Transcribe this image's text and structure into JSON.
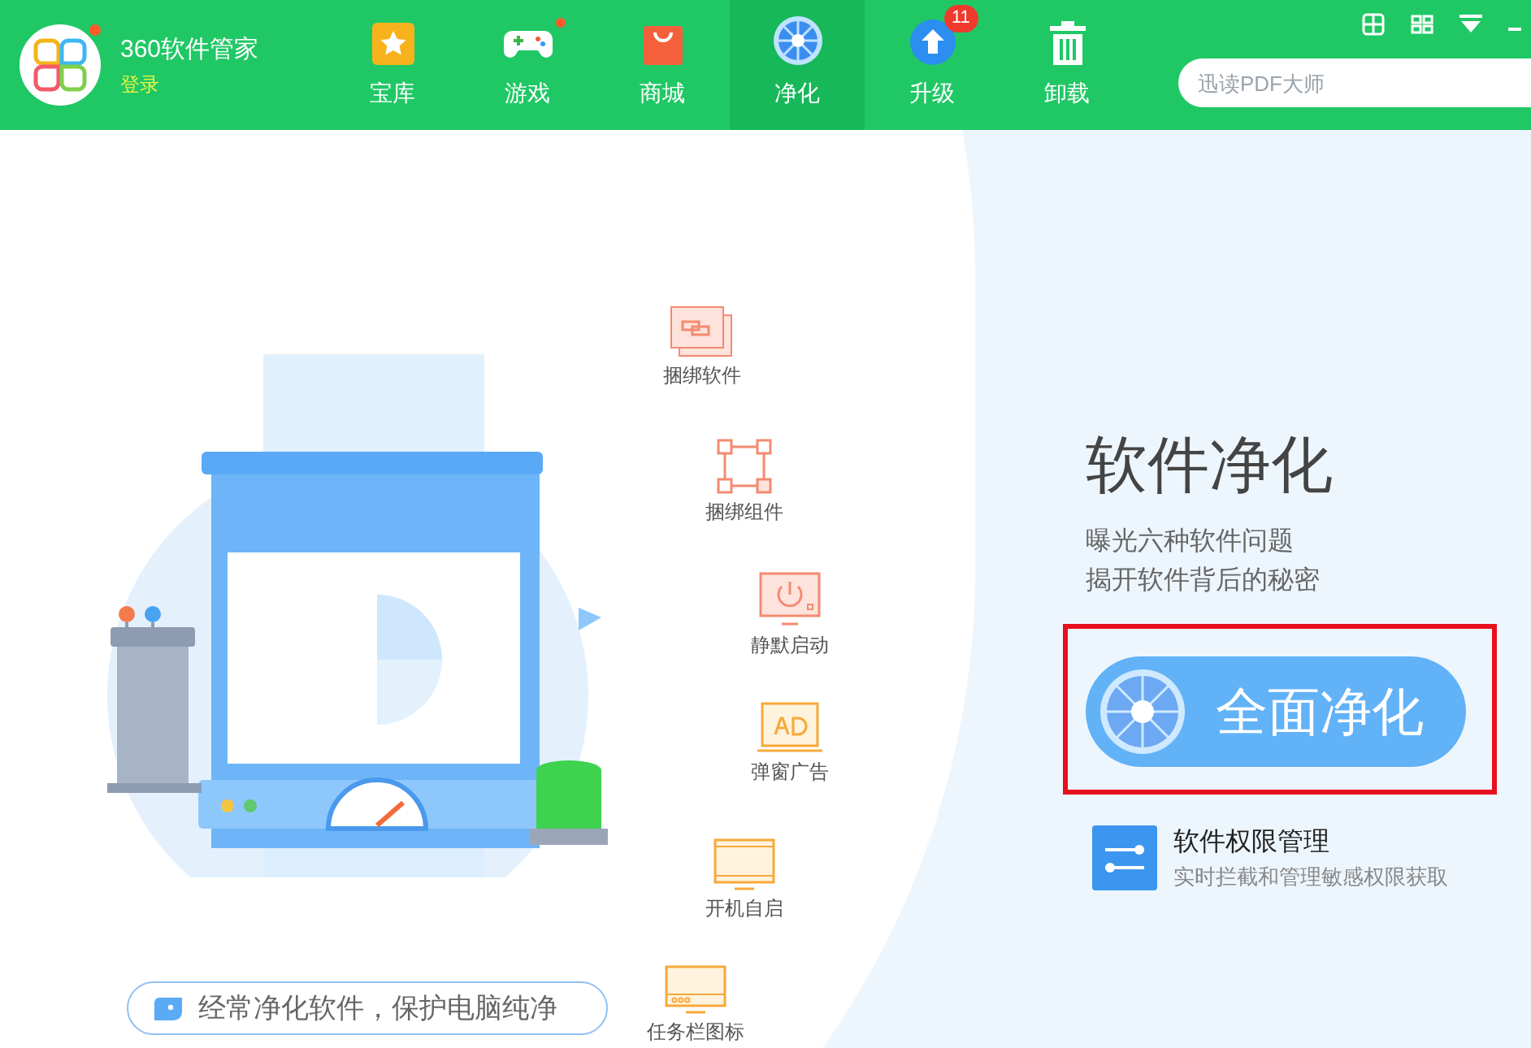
{
  "app": {
    "title": "360软件管家",
    "login": "登录",
    "notification_dot": true
  },
  "tabs": [
    {
      "label": "宝库",
      "kind": "star",
      "selected": false,
      "dot": false
    },
    {
      "label": "游戏",
      "kind": "gamepad",
      "selected": false,
      "dot": true
    },
    {
      "label": "商城",
      "kind": "bag",
      "selected": false,
      "dot": false
    },
    {
      "label": "净化",
      "kind": "fan",
      "selected": true,
      "dot": false
    },
    {
      "label": "升级",
      "kind": "upload",
      "selected": false,
      "dot": false,
      "badge": "11"
    },
    {
      "label": "卸载",
      "kind": "trash",
      "selected": false,
      "dot": false
    }
  ],
  "search": {
    "placeholder": "迅读PDF大师"
  },
  "features": [
    {
      "label": "捆绑软件",
      "kind": "bundle"
    },
    {
      "label": "捆绑组件",
      "kind": "nodes"
    },
    {
      "label": "静默启动",
      "kind": "power"
    },
    {
      "label": "弹窗广告",
      "kind": "ad"
    },
    {
      "label": "开机自启",
      "kind": "monitor"
    },
    {
      "label": "任务栏图标",
      "kind": "taskbar"
    }
  ],
  "hint": "经常净化软件，保护电脑纯净",
  "panel": {
    "title": "软件净化",
    "lines": [
      "曝光六种软件问题",
      "揭开软件背后的秘密"
    ],
    "button": "全面净化",
    "highlighted": true,
    "permission": {
      "title": "软件权限管理",
      "subtitle": "实时拦截和管理敏感权限获取"
    }
  }
}
